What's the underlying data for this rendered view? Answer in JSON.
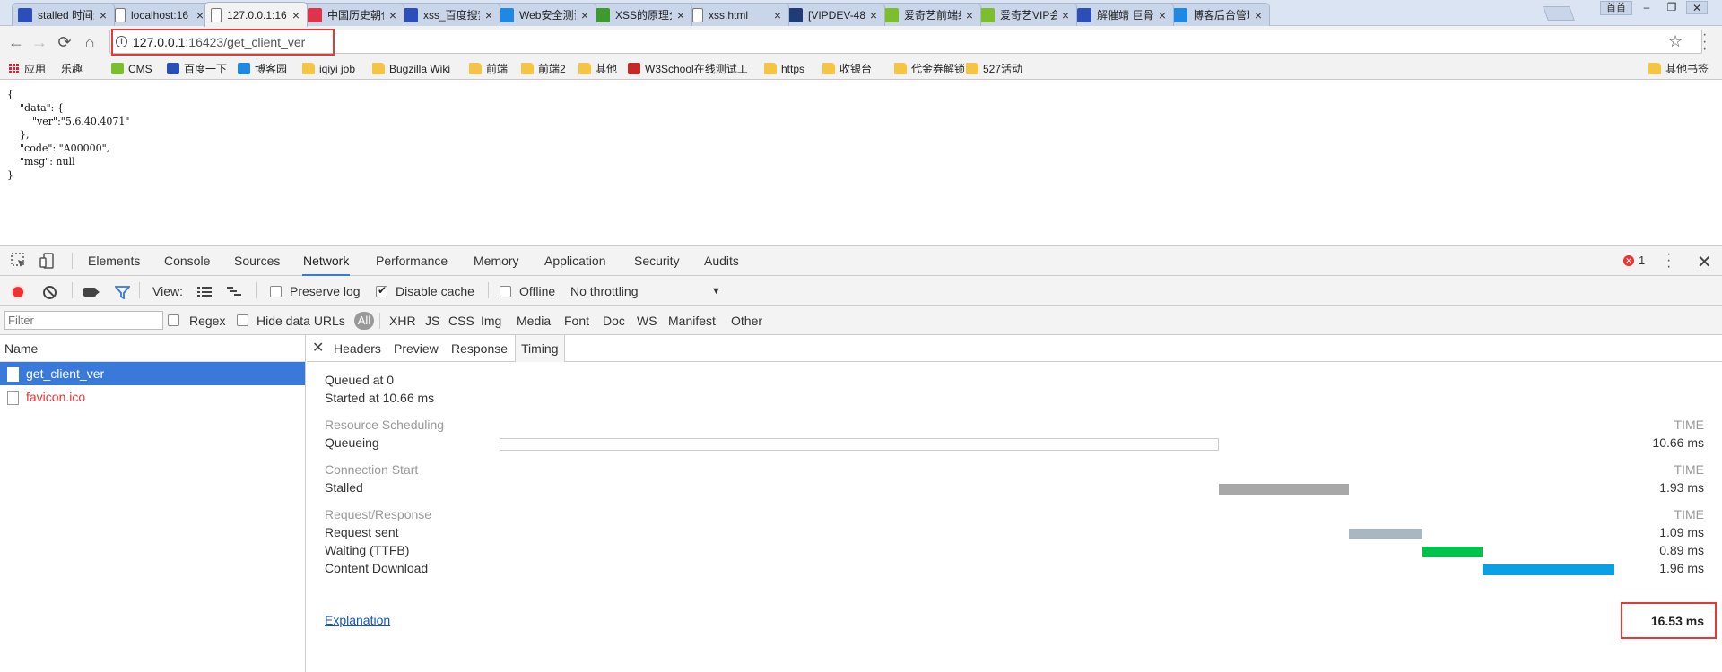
{
  "browser": {
    "tabs": [
      {
        "title": "stalled 时间过",
        "favicon": "paw-icon",
        "color": "#2b4eb8"
      },
      {
        "title": "localhost:16",
        "favicon": "page-icon",
        "color": "#ffffff"
      },
      {
        "title": "127.0.0.1:16",
        "favicon": "page-icon",
        "color": "#ffffff",
        "active": true
      },
      {
        "title": "中国历史朝代",
        "favicon": "pinwheel-icon",
        "color": "#e0334b"
      },
      {
        "title": "xss_百度搜索",
        "favicon": "paw-icon",
        "color": "#2b4eb8"
      },
      {
        "title": "Web安全测试",
        "favicon": "globe-icon",
        "color": "#1e88e5"
      },
      {
        "title": "XSS的原理分",
        "favicon": "f-icon",
        "color": "#3e9a2d"
      },
      {
        "title": "xss.html",
        "favicon": "page-icon",
        "color": "#ffffff"
      },
      {
        "title": "[VIPDEV-48",
        "favicon": "pms-icon",
        "color": "#1f3b78"
      },
      {
        "title": "爱奇艺前端组",
        "favicon": "iqiyi-icon",
        "color": "#7cbf2a"
      },
      {
        "title": "爱奇艺VIP会员",
        "favicon": "iqiyi-icon",
        "color": "#7cbf2a"
      },
      {
        "title": "解催靖 巨骨",
        "favicon": "paw-icon",
        "color": "#2b4eb8"
      },
      {
        "title": "博客后台管理",
        "favicon": "globe-icon",
        "color": "#1e88e5"
      }
    ],
    "user_button": "首首",
    "url_host": "127.0.0.1",
    "url_rest": ":16423/get_client_ver",
    "bookmarks": [
      {
        "label": "应用",
        "icon": "apps-icon"
      },
      {
        "label": "乐趣",
        "icon": "page-icon"
      },
      {
        "label": "CMS",
        "icon": "iqiyi-icon"
      },
      {
        "label": "百度一下",
        "icon": "paw-icon"
      },
      {
        "label": "博客园",
        "icon": "globe-icon"
      },
      {
        "label": "iqiyi job",
        "icon": "folder-icon"
      },
      {
        "label": "Bugzilla Wiki",
        "icon": "folder-icon"
      },
      {
        "label": "前端",
        "icon": "folder-icon"
      },
      {
        "label": "前端2",
        "icon": "folder-icon"
      },
      {
        "label": "其他",
        "icon": "folder-icon"
      },
      {
        "label": "W3School在线测试工",
        "icon": "w3-icon"
      },
      {
        "label": "https",
        "icon": "folder-icon"
      },
      {
        "label": "收银台",
        "icon": "folder-icon"
      },
      {
        "label": "代金券解锁",
        "icon": "folder-icon"
      },
      {
        "label": "527活动",
        "icon": "folder-icon"
      }
    ],
    "other_bookmarks": "其他书签"
  },
  "page": {
    "json_lines": [
      "{",
      "    \"data\": {",
      "        \"ver\":\"5.6.40.4071\"",
      "    },",
      "    \"code\": \"A00000\",",
      "    \"msg\": null",
      "}"
    ]
  },
  "devtools": {
    "tabs": [
      "Elements",
      "Console",
      "Sources",
      "Network",
      "Performance",
      "Memory",
      "Application",
      "Security",
      "Audits"
    ],
    "active_tab": "Network",
    "error_count": "1",
    "toolbar": {
      "view_label": "View:",
      "preserve_log": "Preserve log",
      "disable_cache": "Disable cache",
      "offline": "Offline",
      "throttling": "No throttling"
    },
    "filter": {
      "placeholder": "Filter",
      "regex": "Regex",
      "hide_data_urls": "Hide data URLs",
      "all": "All",
      "types": [
        "XHR",
        "JS",
        "CSS",
        "Img",
        "Media",
        "Font",
        "Doc",
        "WS",
        "Manifest",
        "Other"
      ]
    },
    "requests": {
      "header": "Name",
      "rows": [
        {
          "name": "get_client_ver",
          "selected": true
        },
        {
          "name": "favicon.ico",
          "error": true
        }
      ]
    },
    "detail": {
      "tabs": [
        "Headers",
        "Preview",
        "Response",
        "Timing"
      ],
      "active_tab": "Timing",
      "queued_at": "Queued at 0",
      "started_at": "Started at 10.66 ms",
      "time_header": "TIME",
      "sections": [
        {
          "title": "Resource Scheduling",
          "rows": [
            {
              "label": "Queueing",
              "time": "10.66 ms",
              "color": "#ffffff",
              "start_ms": 0,
              "dur_ms": 10.66
            }
          ]
        },
        {
          "title": "Connection Start",
          "rows": [
            {
              "label": "Stalled",
              "time": "1.93 ms",
              "color": "#a8a8a8",
              "start_ms": 10.66,
              "dur_ms": 1.93
            }
          ]
        },
        {
          "title": "Request/Response",
          "rows": [
            {
              "label": "Request sent",
              "time": "1.09 ms",
              "color": "#a9b7c0",
              "start_ms": 12.59,
              "dur_ms": 1.09
            },
            {
              "label": "Waiting (TTFB)",
              "time": "0.89 ms",
              "color": "#00c34d",
              "start_ms": 13.68,
              "dur_ms": 0.89
            },
            {
              "label": "Content Download",
              "time": "1.96 ms",
              "color": "#0aa0e6",
              "start_ms": 14.57,
              "dur_ms": 1.96
            }
          ]
        }
      ],
      "explanation": "Explanation",
      "total": "16.53 ms",
      "total_ms": 16.53
    }
  },
  "colors": {
    "accent": "#3879d9",
    "highlight_box": "#e53935",
    "error": "#e33333"
  }
}
